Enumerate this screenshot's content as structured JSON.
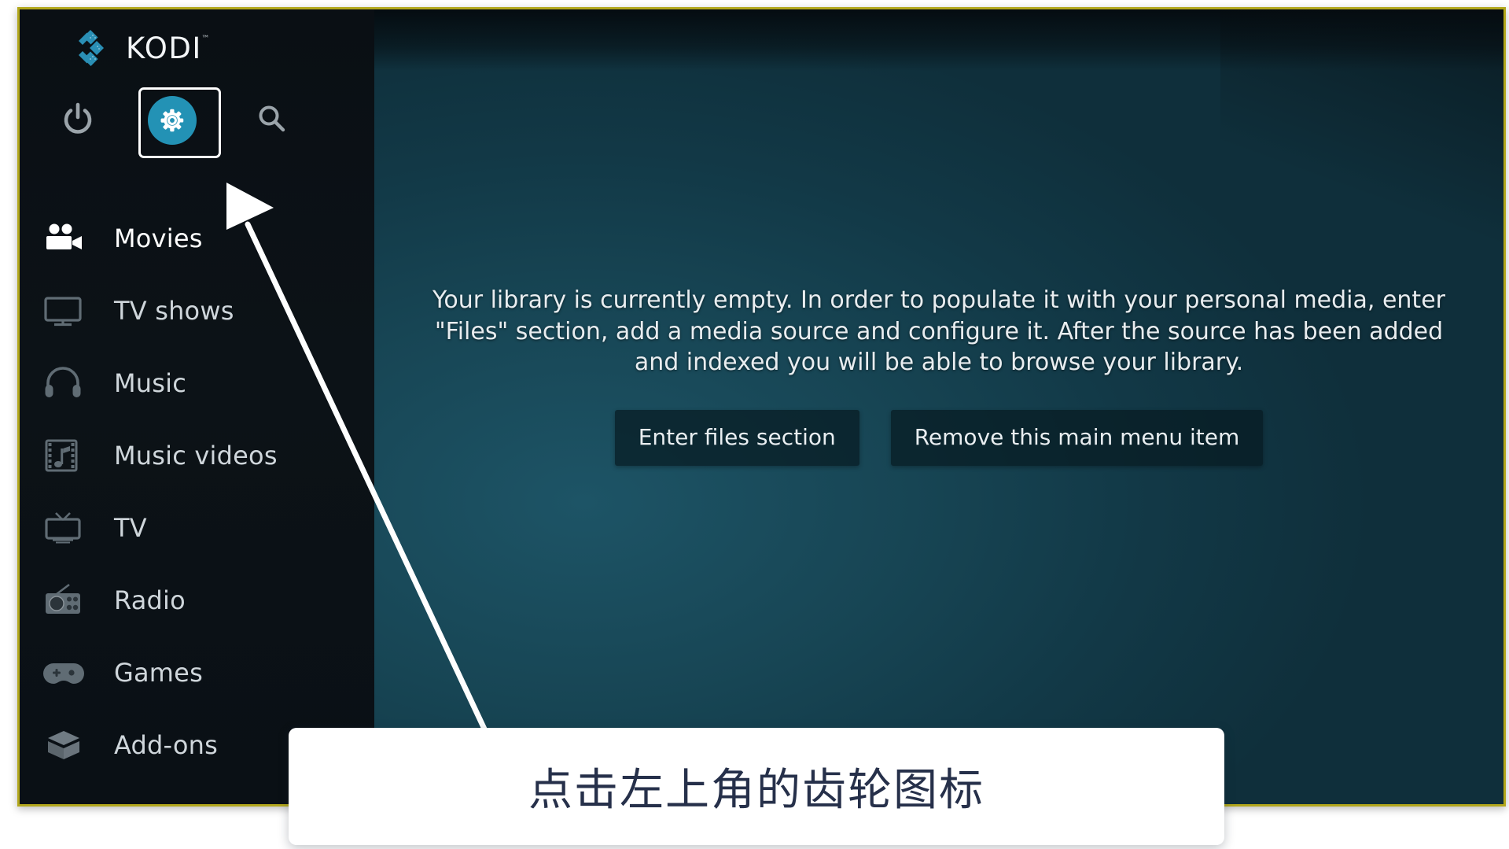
{
  "brand": {
    "name": "KODI",
    "trademark": "™",
    "logo_icon": "kodi-diamond-logo"
  },
  "toolbar": {
    "power_icon": "power-icon",
    "settings_icon": "gear-icon",
    "search_icon": "search-icon",
    "focused_item": "settings"
  },
  "sidebar": {
    "items": [
      {
        "label": "Movies",
        "icon": "movie-camera-icon",
        "active": true
      },
      {
        "label": "TV shows",
        "icon": "television-icon",
        "active": false
      },
      {
        "label": "Music",
        "icon": "headphones-icon",
        "active": false
      },
      {
        "label": "Music videos",
        "icon": "film-note-icon",
        "active": false
      },
      {
        "label": "TV",
        "icon": "retro-tv-icon",
        "active": false
      },
      {
        "label": "Radio",
        "icon": "radio-icon",
        "active": false
      },
      {
        "label": "Games",
        "icon": "gamepad-icon",
        "active": false
      },
      {
        "label": "Add-ons",
        "icon": "addons-box-icon",
        "active": false
      }
    ]
  },
  "main": {
    "empty_message": "Your library is currently empty. In order to populate it with your personal media, enter \"Files\" section, add a media source and configure it. After the source has been added and indexed you will be able to browse your library.",
    "buttons": [
      {
        "label": "Enter files section"
      },
      {
        "label": "Remove this main menu item"
      }
    ]
  },
  "annotation": {
    "callout_text": "点击左上角的齿轮图标",
    "pointer_icon": "arrow-pointer-icon"
  },
  "colors": {
    "accent_teal": "#2392b5",
    "frame_border": "#b2a71c",
    "sidebar_bg": "#0b1116",
    "main_bg": "#174554",
    "callout_text": "#26304a"
  }
}
